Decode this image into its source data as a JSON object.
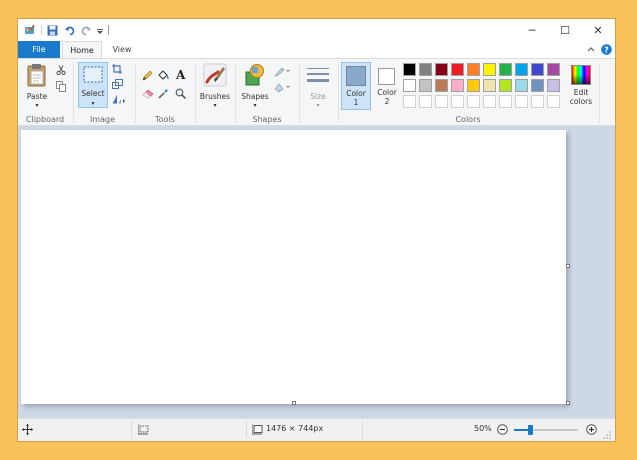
{
  "window": {
    "minimize_glyph": "─",
    "maximize_glyph": "☐",
    "close_glyph": "✕"
  },
  "tabs": {
    "file": "File",
    "home": "Home",
    "view": "View"
  },
  "ribbon": {
    "clipboard": {
      "paste": "Paste",
      "group": "Clipboard"
    },
    "image": {
      "select": "Select",
      "group": "Image"
    },
    "tools": {
      "group": "Tools",
      "text_glyph": "A"
    },
    "brushes": {
      "label": "Brushes"
    },
    "shapes": {
      "label": "Shapes",
      "group": "Shapes"
    },
    "size": {
      "label": "Size"
    },
    "color1": {
      "line1": "Color",
      "line2": "1",
      "value": "#8aa9c9"
    },
    "color2": {
      "line1": "Color",
      "line2": "2",
      "value": "#ffffff"
    },
    "colors": {
      "group": "Colors",
      "row1": [
        "#000000",
        "#7f7f7f",
        "#880015",
        "#ed1c24",
        "#ff7f27",
        "#fff200",
        "#22b14c",
        "#00a2e8",
        "#3f48cc",
        "#a349a4"
      ],
      "row2": [
        "#ffffff",
        "#c3c3c3",
        "#b97a57",
        "#ffaec9",
        "#ffc90e",
        "#efe4b0",
        "#b5e61d",
        "#99d9ea",
        "#7092be",
        "#c8bfe7"
      ]
    },
    "edit_colors": {
      "line1": "Edit",
      "line2": "colors"
    }
  },
  "status": {
    "dimensions": "1476 × 744px",
    "zoom": "50%",
    "zoom_level_fraction": 0.25
  }
}
